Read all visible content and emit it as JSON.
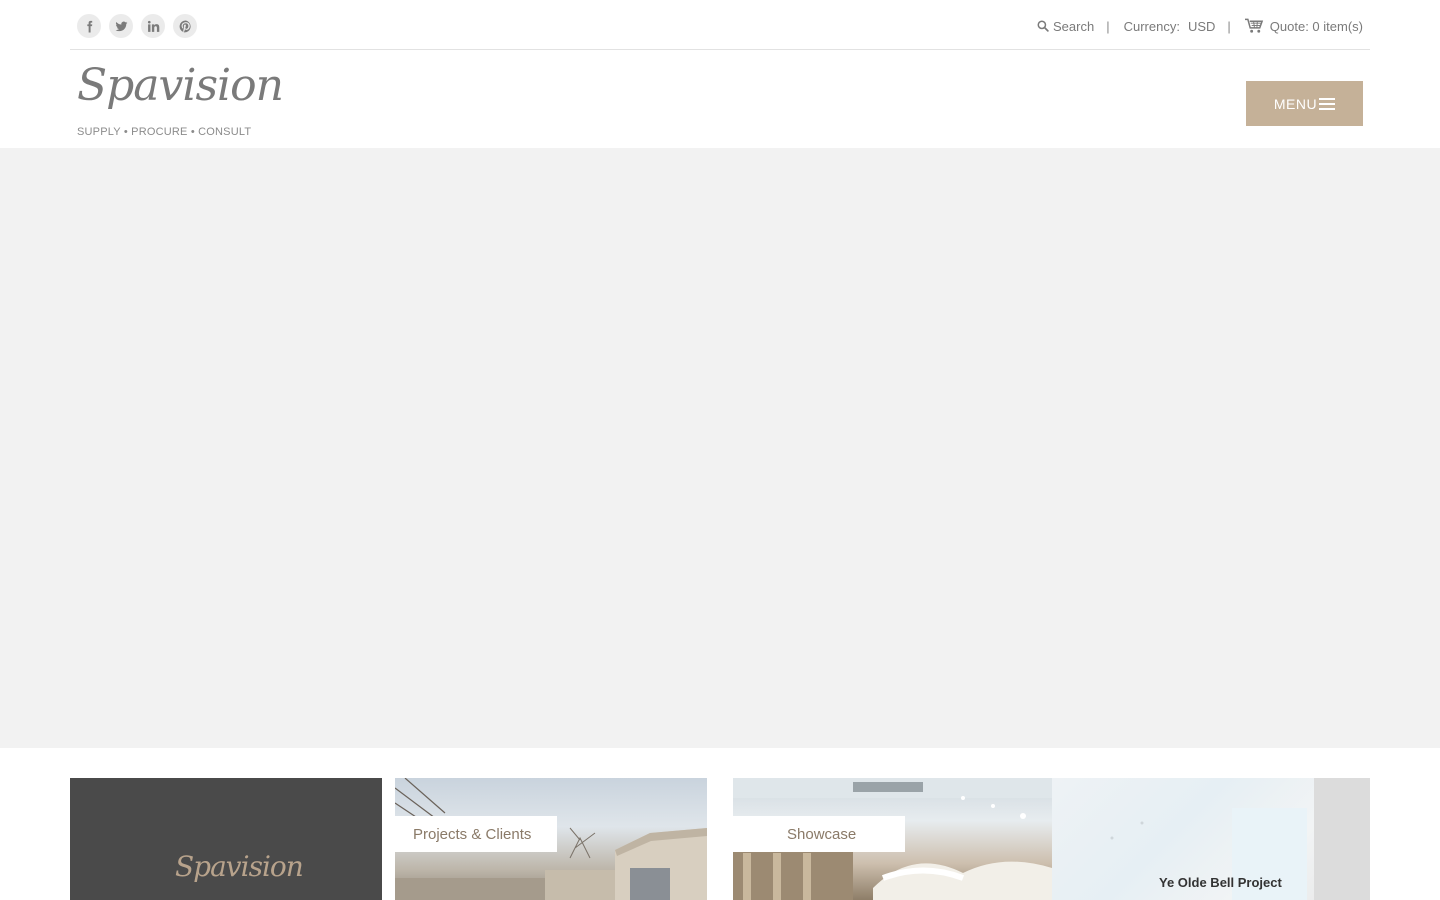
{
  "topbar": {
    "social": [
      {
        "icon": "facebook-icon",
        "name": "facebook"
      },
      {
        "icon": "twitter-icon",
        "name": "twitter"
      },
      {
        "icon": "linkedin-icon",
        "name": "linkedin"
      },
      {
        "icon": "pinterest-icon",
        "name": "pinterest"
      }
    ],
    "search_label": "Search",
    "separator": "|",
    "currency_label": "Currency:",
    "currency_value": "USD",
    "quote_label": "Quote: 0 item(s)"
  },
  "header": {
    "logo_text": "Spavision",
    "tagline": "SUPPLY • PROCURE • CONSULT",
    "menu_label": "MENU"
  },
  "tiles": {
    "brand_logo": "Spavision",
    "projects_label": "Projects & Clients",
    "showcase_label": "Showcase",
    "project_caption": "Ye Olde Bell Project"
  },
  "colors": {
    "accent": "#c5b198",
    "text": "#7a7a7a",
    "hero_bg": "#f2f2f2",
    "brand_tile": "#4a4a4a"
  }
}
